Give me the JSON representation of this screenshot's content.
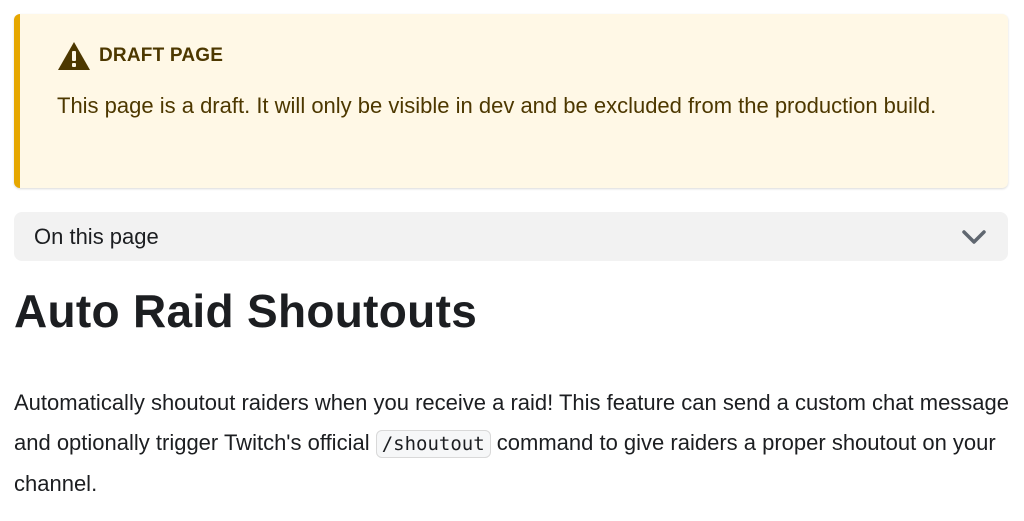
{
  "admonition": {
    "type": "warning",
    "icon": "warning-triangle-icon",
    "title": "DRAFT PAGE",
    "body": "This page is a draft. It will only be visible in dev and be excluded from the production build.",
    "accent_color": "#e6a700",
    "background_color": "#fff8e6"
  },
  "toc": {
    "label": "On this page",
    "icon": "chevron-down-icon"
  },
  "page": {
    "title": "Auto Raid Shoutouts",
    "intro_before_code": "Automatically shoutout raiders when you receive a raid! This feature can send a custom chat message and optionally trigger Twitch's official ",
    "intro_code": "/shoutout",
    "intro_after_code": " command to give raiders a proper shoutout on your channel."
  }
}
